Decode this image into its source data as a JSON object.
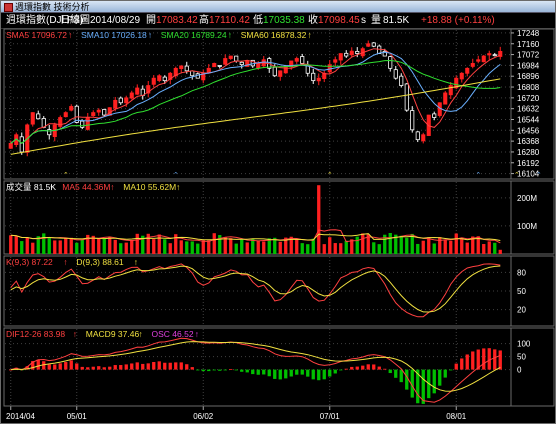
{
  "window": {
    "title": "週環指數 技術分析"
  },
  "info": {
    "name": "週環指數(DJI.FS)",
    "period": "日線圖",
    "date": "2014/08/29",
    "open_label": "開",
    "open": "17083.42",
    "high_label": "高",
    "high": "17110.42",
    "low_label": "低",
    "low": "17035.38",
    "close_label": "收",
    "close": "17098.45",
    "vol_unit": "s",
    "volume_label": "量",
    "volume": "81.5K",
    "change": "+18.88 (+0.11%)"
  },
  "legends": {
    "price": [
      {
        "text": "SMA5 17096.72",
        "color": "#ff4040"
      },
      {
        "text": "SMA10 17026.18",
        "color": "#6ab0ff"
      },
      {
        "text": "SMA20 16789.24",
        "color": "#30e030"
      },
      {
        "text": "SMA60 16878.32",
        "color": "#f0e040"
      }
    ],
    "volume": [
      {
        "text": "成交量 81.5K",
        "color": "#ffffff"
      },
      {
        "text": "MA5 44.36M",
        "color": "#ff4040"
      },
      {
        "text": "MA10 55.62M",
        "color": "#f0e040"
      }
    ],
    "kd": [
      {
        "text": "K(9,3) 87.22",
        "color": "#ff4040"
      },
      {
        "text": "D(9,3) 88.61",
        "color": "#f0e040"
      }
    ],
    "macd": [
      {
        "text": "DIF12-26 83.98",
        "color": "#ff4040"
      },
      {
        "text": "MACD9 37.46",
        "color": "#f0e040"
      },
      {
        "text": "OSC 46.52",
        "color": "#e040e0"
      }
    ]
  },
  "axes": {
    "price_ticks": [
      "17248",
      "17160",
      "17072",
      "16984",
      "16896",
      "16808",
      "16720",
      "16632",
      "16544",
      "16456",
      "16368",
      "16280",
      "16192",
      "16104"
    ],
    "volume_ticks": [
      "200M",
      "100M"
    ],
    "kd_ticks": [
      "80",
      "50",
      "20"
    ],
    "macd_ticks": [
      "100",
      "50",
      "0"
    ],
    "date_ticks": [
      "2014/04",
      "05/01",
      "06/02",
      "07/01",
      "08/01"
    ]
  },
  "colors": {
    "up": "#ff2020",
    "down": "#00c000",
    "doji": "#ffffff",
    "grid": "#404040",
    "panel_border": "#6a6a6a"
  },
  "chart_data": {
    "type": "candlestick",
    "price_range": [
      16060,
      17280
    ],
    "volume_max_M": 260,
    "bars": 100,
    "sample_close": [
      16350,
      16420,
      16280,
      16500,
      16600,
      16550,
      16480,
      16420,
      16500,
      16560,
      16600,
      16650,
      16520,
      16480,
      16560,
      16600,
      16620,
      16580,
      16640,
      16700,
      16680,
      16720,
      16760,
      16800,
      16740,
      16820,
      16880,
      16900,
      16860,
      16920,
      16960,
      16980,
      16940,
      16900,
      16880,
      16920,
      16960,
      17000,
      16980,
      17040,
      17060,
      17020,
      16990,
      17020,
      16980,
      17000,
      17030,
      16960,
      16900,
      16940,
      16980,
      17020,
      17040,
      17000,
      16920,
      16860,
      16880,
      16920,
      16990,
      17030,
      17080,
      17060,
      17100,
      17080,
      17120,
      17160,
      17140,
      17080,
      17060,
      16960,
      16880,
      16820,
      16620,
      16460,
      16380,
      16420,
      16580,
      16560,
      16680,
      16760,
      16820,
      16880,
      16920,
      16960,
      17000,
      17030,
      17060,
      17080,
      17070,
      17098
    ],
    "volume_spike_M": 245,
    "kd_range": [
      0,
      100
    ],
    "macd_range": [
      -140,
      160
    ]
  }
}
